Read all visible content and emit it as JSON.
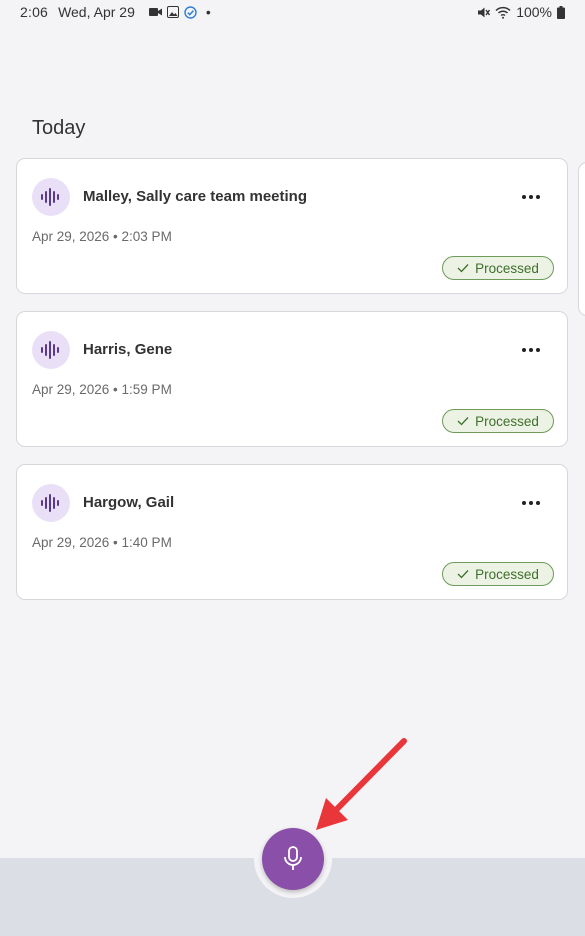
{
  "status_bar": {
    "time": "2:06",
    "date": "Wed, Apr 29",
    "battery": "100%"
  },
  "section_title": "Today",
  "recordings": [
    {
      "title": "Malley, Sally care team meeting",
      "meta": "Apr 29, 2026 • 2:03 PM",
      "status": "Processed"
    },
    {
      "title": "Harris, Gene",
      "meta": "Apr 29, 2026 • 1:59 PM",
      "status": "Processed"
    },
    {
      "title": "Hargow, Gail",
      "meta": "Apr 29, 2026 • 1:40 PM",
      "status": "Processed"
    }
  ],
  "colors": {
    "accent": "#8a4fa8",
    "avatar_bg": "#e9e0f8",
    "badge_border": "#6e9a5a",
    "badge_bg": "#ecf3e4",
    "arrow": "#e8363a"
  },
  "icons": {
    "recording": "audio-waveform-icon",
    "more": "more-horizontal-icon",
    "status": "check-icon",
    "fab": "microphone-icon"
  }
}
